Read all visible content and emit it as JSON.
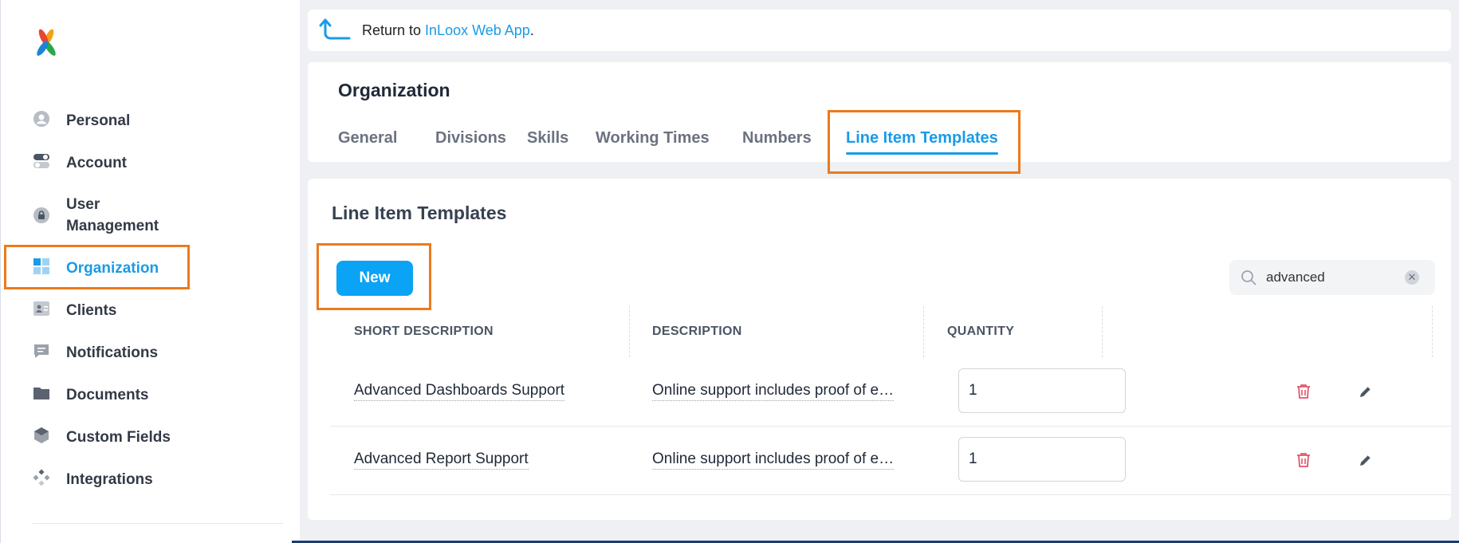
{
  "sidebar": {
    "items": [
      {
        "label": "Personal",
        "icon": "user-icon"
      },
      {
        "label": "Account",
        "icon": "toggle-icon"
      },
      {
        "label": "User Management",
        "icon": "lock-icon"
      },
      {
        "label": "Organization",
        "icon": "grid-icon",
        "active": true
      },
      {
        "label": "Clients",
        "icon": "contact-card-icon"
      },
      {
        "label": "Notifications",
        "icon": "chat-icon"
      },
      {
        "label": "Documents",
        "icon": "folder-icon"
      },
      {
        "label": "Custom Fields",
        "icon": "cube-icon"
      },
      {
        "label": "Integrations",
        "icon": "puzzle-icon"
      }
    ]
  },
  "return_bar": {
    "prefix": "Return to ",
    "link": "InLoox Web App",
    "suffix": "."
  },
  "organization": {
    "title": "Organization",
    "tabs": [
      "General",
      "Divisions",
      "Skills",
      "Working Times",
      "Numbers",
      "Line Item Templates"
    ],
    "active_tab": "Line Item Templates"
  },
  "line_items": {
    "title": "Line Item Templates",
    "new_button": "New",
    "search_value": "advanced",
    "columns": [
      "SHORT DESCRIPTION",
      "DESCRIPTION",
      "QUANTITY"
    ],
    "rows": [
      {
        "short": "Advanced Dashboards Support",
        "description": "Online support includes proof of e…",
        "quantity": "1"
      },
      {
        "short": "Advanced Report Support",
        "description": "Online support includes proof of e…",
        "quantity": "1"
      }
    ]
  },
  "colors": {
    "accent": "#1a9be6",
    "highlight": "#ec7a1c",
    "delete": "#e0556b"
  }
}
